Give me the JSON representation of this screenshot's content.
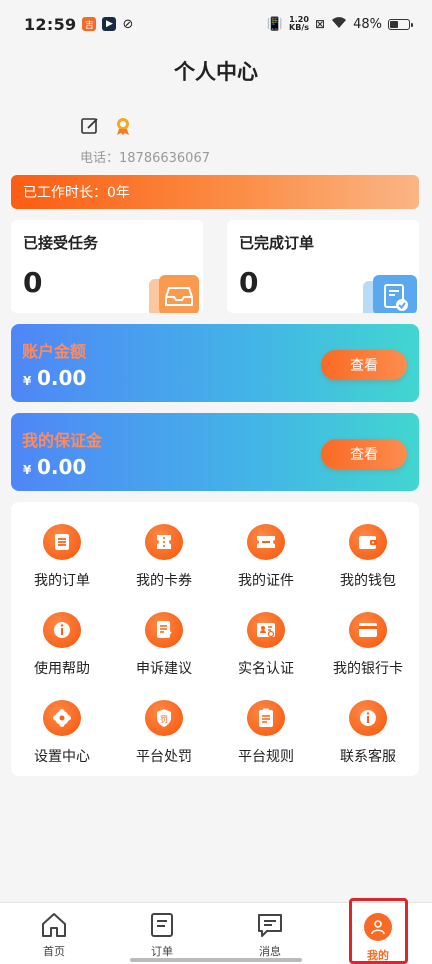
{
  "status_bar": {
    "time": "12:59",
    "net_speed_value": "1.20",
    "net_speed_unit": "KB/s",
    "battery": "48%",
    "battery_level": 0.48
  },
  "header": {
    "title": "个人中心"
  },
  "profile": {
    "edit_icon": "edit-icon",
    "badge_icon": "badge-icon",
    "phone": "电话：18786636067"
  },
  "work_duration": "已工作时长：0年",
  "stats": [
    {
      "label": "已接受任务",
      "value": "0",
      "icon": "inbox-icon"
    },
    {
      "label": "已完成订单",
      "value": "0",
      "icon": "clipboard-check-icon"
    }
  ],
  "accounts": [
    {
      "label": "账户金额",
      "currency": "¥",
      "amount": "0.00",
      "button": "查看"
    },
    {
      "label": "我的保证金",
      "currency": "¥",
      "amount": "0.00",
      "button": "查看"
    }
  ],
  "grid": [
    {
      "label": "我的订单",
      "icon": "order-icon"
    },
    {
      "label": "我的卡券",
      "icon": "coupon-icon"
    },
    {
      "label": "我的证件",
      "icon": "certificate-icon"
    },
    {
      "label": "我的钱包",
      "icon": "wallet-icon"
    },
    {
      "label": "使用帮助",
      "icon": "help-icon"
    },
    {
      "label": "申诉建议",
      "icon": "feedback-icon"
    },
    {
      "label": "实名认证",
      "icon": "id-card-icon"
    },
    {
      "label": "我的银行卡",
      "icon": "bank-card-icon"
    },
    {
      "label": "设置中心",
      "icon": "settings-icon"
    },
    {
      "label": "平台处罚",
      "icon": "penalty-icon"
    },
    {
      "label": "平台规则",
      "icon": "rules-icon"
    },
    {
      "label": "联系客服",
      "icon": "customer-service-icon"
    }
  ],
  "tabs": [
    {
      "label": "首页",
      "icon": "home-icon"
    },
    {
      "label": "订单",
      "icon": "orders-icon"
    },
    {
      "label": "消息",
      "icon": "message-icon"
    },
    {
      "label": "我的",
      "icon": "user-icon",
      "active": true
    }
  ],
  "colors": {
    "accent": "#f96a24",
    "card_gradient": [
      "#4f86f7",
      "#41d6d0"
    ],
    "highlight": "#e0242b"
  }
}
